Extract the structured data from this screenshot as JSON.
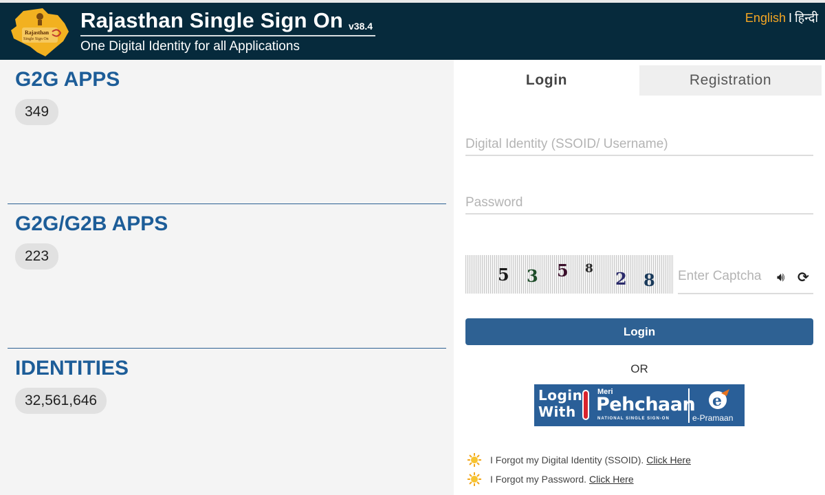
{
  "header": {
    "title": "Rajasthan Single Sign On",
    "version": "v38.4",
    "subtitle": "One Digital Identity for all Applications",
    "logo_text": [
      "Rajasthan",
      "Single Sign On"
    ],
    "lang_en": "English",
    "lang_sep": "I",
    "lang_hi": "हिन्दी"
  },
  "stats": [
    {
      "title": "G2G APPS",
      "count": "349"
    },
    {
      "title": "G2G/G2B APPS",
      "count": "223"
    },
    {
      "title": "IDENTITIES",
      "count": "32,561,646"
    }
  ],
  "login": {
    "tabs": [
      "Login",
      "Registration"
    ],
    "username_placeholder": "Digital Identity (SSOID/ Username)",
    "password_placeholder": "Password",
    "captcha_digits": [
      "5",
      "3",
      "5",
      "8",
      "2",
      "8"
    ],
    "captcha_placeholder": "Enter Captcha",
    "audio_icon": "speaker-icon",
    "refresh_icon": "refresh-icon",
    "login_button": "Login",
    "or_text": "OR",
    "pehchaan": {
      "login_with": [
        "Login",
        "With"
      ],
      "meri": "Meri",
      "name": "Pehchaan",
      "tagline": "NATIONAL SINGLE SIGN-ON",
      "epramaan": "e-Pramaan"
    },
    "help": [
      {
        "text": "I Forgot my Digital Identity (SSOID).",
        "link": "Click Here"
      },
      {
        "text": "I Forgot my Password.",
        "link": "Click Here"
      }
    ]
  },
  "colors": {
    "header_bg": "#062a3c",
    "stat_title": "#1d5d98",
    "login_button": "#2e6193",
    "lang_en": "#f5a623"
  }
}
